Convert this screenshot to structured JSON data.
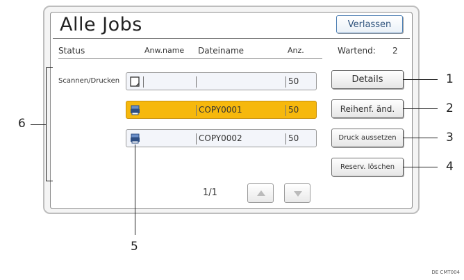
{
  "window": {
    "title": "Alle Jobs",
    "exit_label": "Verlassen"
  },
  "table": {
    "headers": {
      "status": "Status",
      "app": "Anw.name",
      "file": "Dateiname",
      "count": "Anz."
    },
    "waiting_label": "Wartend:",
    "waiting_count": "2",
    "status_label": "Scannen/Drucken",
    "rows": [
      {
        "icon": "document-icon",
        "app": "",
        "file": "",
        "count": "50",
        "selected": false
      },
      {
        "icon": "printer-icon",
        "app": "",
        "file": "COPY0001",
        "count": "50",
        "selected": true
      },
      {
        "icon": "printer-icon",
        "app": "",
        "file": "COPY0002",
        "count": "50",
        "selected": false
      }
    ]
  },
  "actions": {
    "details": "Details",
    "reorder": "Reihenf. änd.",
    "suspend": "Druck aussetzen",
    "delete_reservation": "Reserv. löschen"
  },
  "pagination": {
    "label": "1/1"
  },
  "callouts": {
    "c1": "1",
    "c2": "2",
    "c3": "3",
    "c4": "4",
    "c5": "5",
    "c6": "6"
  },
  "footer_code": "DE CMT004",
  "colors": {
    "selected_row": "#f6b80d",
    "exit_border": "#4d7fb3"
  }
}
